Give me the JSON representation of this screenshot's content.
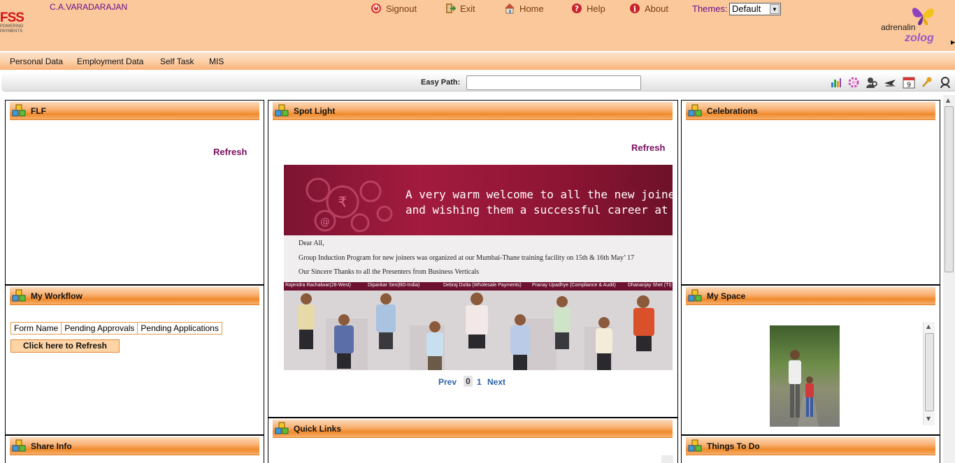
{
  "header": {
    "logo_text": "FSS",
    "logo_tagline": [
      "POWERING",
      "PAYMENTS"
    ],
    "username": "C.A.VARADARAJAN",
    "nav": [
      {
        "label": "Signout",
        "icon": "signout-icon"
      },
      {
        "label": "Exit",
        "icon": "exit-icon"
      },
      {
        "label": "Home",
        "icon": "home-icon"
      },
      {
        "label": "Help",
        "icon": "help-icon"
      },
      {
        "label": "About",
        "icon": "info-icon"
      }
    ],
    "themes_label": "Themes:",
    "theme_selected": "Default",
    "brand": {
      "adrenalin": "adrenalin",
      "zolog": "zolog"
    }
  },
  "menu": [
    "Personal Data",
    "Employment Data",
    "Self Task",
    "MIS"
  ],
  "easy_path": {
    "label": "Easy Path:",
    "value": ""
  },
  "toolbar_icons": [
    "chart-icon",
    "gear-icon",
    "user-search-icon",
    "plane-icon",
    "calendar-icon",
    "key-icon",
    "person-icon"
  ],
  "calendar_day": "9",
  "panels": {
    "flf": {
      "title": "FLF",
      "refresh": "Refresh"
    },
    "workflow": {
      "title": "My Workflow",
      "columns": [
        "Form Name",
        "Pending Approvals",
        "Pending Applications"
      ],
      "refresh_button": "Click here to Refresh"
    },
    "share_info": {
      "title": "Share Info"
    },
    "spotlight": {
      "title": "Spot Light",
      "refresh": "Refresh",
      "banner": {
        "headline_1": "A very warm welcome to all the new joiners",
        "headline_2": "and wishing them a successful career at FSS",
        "greeting": "Dear All,",
        "line_1": "Group Induction Program for new joiners  was organized at  our Mumbai-Thane training facility on 15th & 16th May’ 17",
        "line_2": "Our Sincere Thanks to all the Presenters from Business Verticals",
        "presenters": [
          "Rajendra Rachalwar(28-West)",
          "Dipankar Sen(BD-India)",
          "Debraj Dutta (Wholesale Payments)",
          "Pranay Upadhye (Compliance & Audit)",
          "Dhananjay Shet (TI)"
        ]
      },
      "pager": {
        "prev": "Prev",
        "pages": [
          "0",
          "1"
        ],
        "current": "0",
        "next": "Next"
      }
    },
    "quick_links": {
      "title": "Quick Links"
    },
    "celebrations": {
      "title": "Celebrations"
    },
    "my_space": {
      "title": "My Space"
    },
    "things_to_do": {
      "title": "Things To Do"
    }
  },
  "colors": {
    "header_bg": "#fac89a",
    "accent_orange": "#f08a2b",
    "username": "#6a0f8e",
    "refresh": "#7a0e5f",
    "pager_link": "#2d63a8"
  }
}
